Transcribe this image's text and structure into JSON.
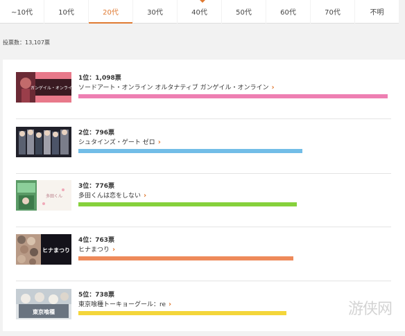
{
  "tabs": [
    {
      "label": "~10代",
      "active": false
    },
    {
      "label": "10代",
      "active": false
    },
    {
      "label": "20代",
      "active": true
    },
    {
      "label": "30代",
      "active": false
    },
    {
      "label": "40代",
      "active": false
    },
    {
      "label": "50代",
      "active": false
    },
    {
      "label": "60代",
      "active": false
    },
    {
      "label": "70代",
      "active": false
    },
    {
      "label": "不明",
      "active": false
    }
  ],
  "vote_total": "投票数：13,107票",
  "ranking": [
    {
      "rank": "1位：1,098票",
      "votes": 1098,
      "title": "ソードアート・オンライン オルタナティブ ガンゲイル・オンライン",
      "bar_color": "#ee7fb2",
      "thumb_text": "ガンゲイル・オンライン"
    },
    {
      "rank": "2位：796票",
      "votes": 796,
      "title": "シュタインズ・ゲート ゼロ",
      "bar_color": "#72bde7",
      "thumb_text": ""
    },
    {
      "rank": "3位：776票",
      "votes": 776,
      "title": "多田くんは恋をしない",
      "bar_color": "#86d13c",
      "thumb_text": "多田くん"
    },
    {
      "rank": "4位：763票",
      "votes": 763,
      "title": "ヒナまつり",
      "bar_color": "#ee8a5a",
      "thumb_text": "ヒナまつり"
    },
    {
      "rank": "5位：738票",
      "votes": 738,
      "title": "東京喰種トーキョーグール：re",
      "bar_color": "#f4d63a",
      "thumb_text": "東京喰種"
    }
  ],
  "watermark": "游侠网"
}
